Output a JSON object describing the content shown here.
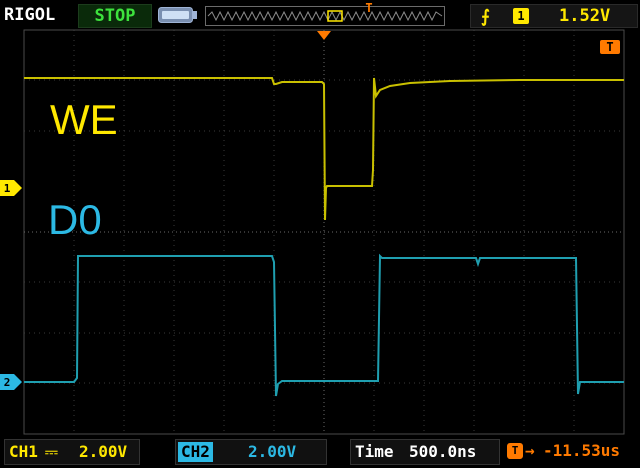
{
  "header": {
    "brand": "RIGOL",
    "run_state": "STOP",
    "trigger": {
      "edge_icon": "rising-edge-icon",
      "source": "1",
      "level": "1.52V"
    }
  },
  "markers": {
    "trigger_top": "T",
    "trigger_right": "T",
    "ch1": "1",
    "ch2": "2"
  },
  "labels": {
    "we": "WE",
    "d0": "D0"
  },
  "footer": {
    "ch1": {
      "label": "CH1",
      "coupling": "⎓",
      "scale": "2.00V"
    },
    "ch2": {
      "label": "CH2",
      "scale": "2.00V"
    },
    "timebase": {
      "label": "Time",
      "value": "500.0ns"
    },
    "trigger_offset": {
      "icon": "T",
      "arrow": "→",
      "value": "-11.53us"
    }
  },
  "colors": {
    "ch1": "#c9c000",
    "ch2": "#1f9fb0",
    "trigger": "#ff7a00",
    "grid": "#3a3a3a"
  }
}
